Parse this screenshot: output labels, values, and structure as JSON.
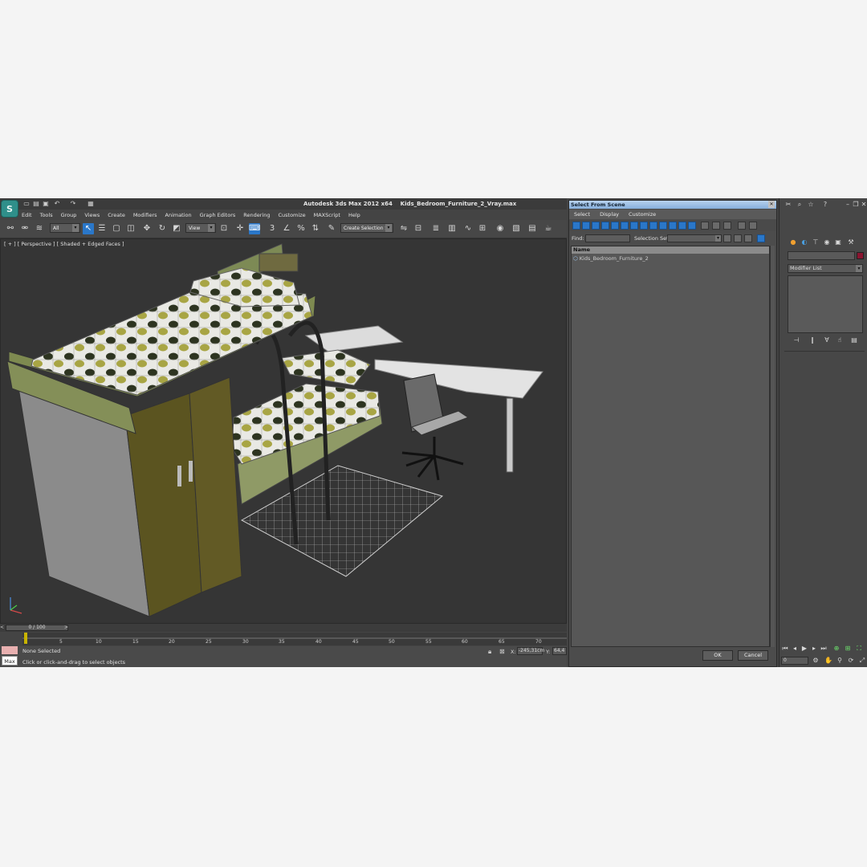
{
  "title_bar": {
    "app_title": "Autodesk 3ds Max  2012 x64",
    "file_name": "Kids_Bedroom_Furniture_2_Vray.max"
  },
  "menu": [
    "Edit",
    "Tools",
    "Group",
    "Views",
    "Create",
    "Modifiers",
    "Animation",
    "Graph Editors",
    "Rendering",
    "Customize",
    "MAXScript",
    "Help"
  ],
  "toolbar": {
    "filter_value": "All",
    "refcoord_value": "View",
    "selection_set_value": "Create Selection Se"
  },
  "viewport": {
    "label": "[ + ] [ Perspective ] [ Shaded + Edged Faces ]"
  },
  "timeline": {
    "slider_label": "0 / 100",
    "ticks": [
      "5",
      "10",
      "15",
      "20",
      "25",
      "30",
      "35",
      "40",
      "45",
      "50",
      "55",
      "60",
      "65",
      "70"
    ]
  },
  "status": {
    "selection": "None Selected",
    "prompt": "Click or click-and-drag to select objects",
    "x_label": "X:",
    "x_value": "-245,31cm",
    "y_label": "Y:",
    "y_value": "64,4",
    "max_label": "Max"
  },
  "dialog": {
    "title": "Select From Scene",
    "menu": [
      "Select",
      "Display",
      "Customize"
    ],
    "find_label": "Find:",
    "selection_set_label": "Selection Set:",
    "column_name": "Name",
    "items": [
      "Kids_Bedroom_Furniture_2"
    ],
    "ok": "OK",
    "cancel": "Cancel"
  },
  "command_panel": {
    "modifier_list": "Modifier List",
    "frame_value": "0"
  },
  "colors": {
    "selection_blue": "#2a77c9",
    "object_color": "#8a1530",
    "ui_dark": "#444444"
  }
}
